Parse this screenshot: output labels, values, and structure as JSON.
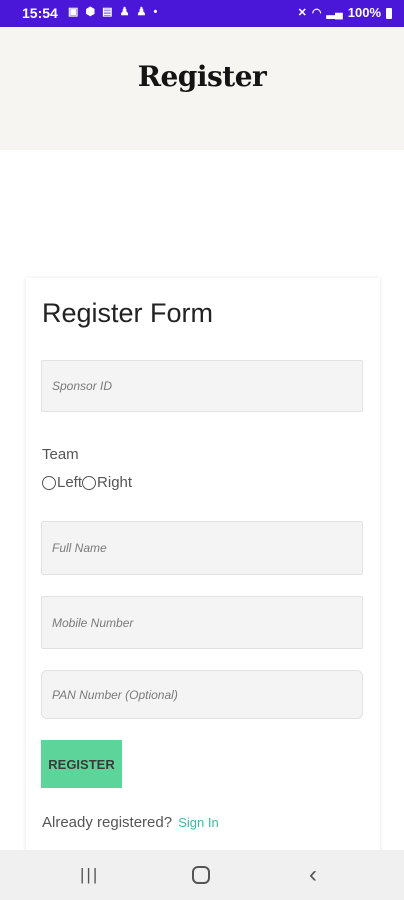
{
  "status_bar": {
    "time": "15:54",
    "battery": "100%",
    "left_icons": [
      "gallery-icon",
      "location-icon",
      "notification-icon",
      "person-icon",
      "person-icon",
      "dot-icon"
    ],
    "right_icons": [
      "mute-icon",
      "wifi-icon",
      "signal-icon",
      "battery-icon"
    ],
    "bg_color": "#4a16d8"
  },
  "header": {
    "title": "Register"
  },
  "form": {
    "title": "Register Form",
    "sponsor_placeholder": "Sponsor ID",
    "team_label": "Team",
    "team_options": [
      "Left",
      "Right"
    ],
    "fullname_placeholder": "Full Name",
    "mobile_placeholder": "Mobile Number",
    "pan_placeholder": "PAN Number (Optional)",
    "register_label": "REGISTER",
    "register_color": "#5dd59a",
    "signin_prompt": "Already registered?",
    "signin_link": "Sign In",
    "signin_color": "#3fb8a0"
  },
  "nav_bar": {
    "recent_glyph": "|||",
    "back_glyph": "‹"
  }
}
